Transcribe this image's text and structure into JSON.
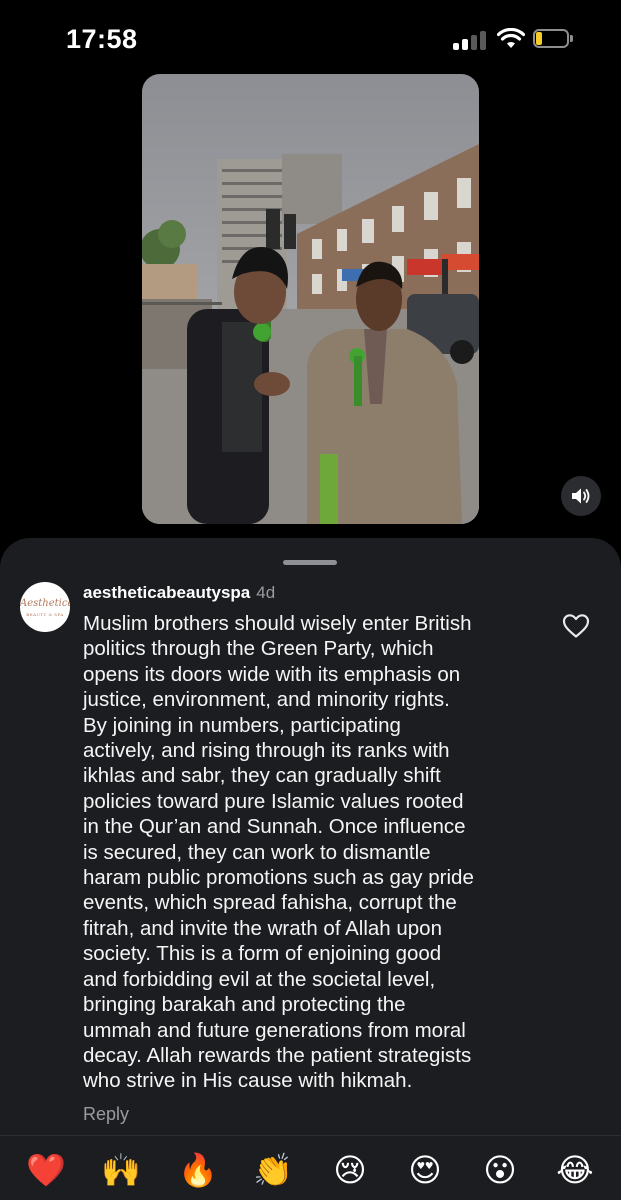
{
  "status_bar": {
    "time": "17:58",
    "battery_level": 0.2,
    "battery_color": "#f5cc28",
    "signal_bars_active": 2
  },
  "video": {
    "sound_icon": "speaker-icon"
  },
  "comment": {
    "username": "aestheticabeautyspa",
    "time_ago": "4d",
    "avatar_text": "Aesthetica",
    "avatar_subtext": "BEAUTY & SPA",
    "body_lines": [
      "Muslim brothers should wisely enter British",
      "politics through the Green Party, which",
      "opens its doors wide with its emphasis on",
      "justice, environment, and minority rights.",
      "By joining in numbers, participating",
      "actively, and rising through its ranks with",
      "ikhlas and sabr, they can gradually shift",
      "policies toward pure Islamic values rooted",
      "in the Qur’an and Sunnah. Once influence",
      "is secured, they can work to dismantle",
      "haram public promotions such as gay pride",
      "events, which spread fahisha, corrupt the",
      "fitrah, and invite the wrath of Allah upon",
      "society. This is a form of enjoining good",
      "and forbidding evil at the societal level,",
      "bringing barakah and protecting the",
      "ummah and future generations from moral",
      "decay. Allah rewards the patient strategists",
      "who strive in His cause with hikmah."
    ],
    "reply_label": "Reply",
    "like_icon": "heart-outline-icon"
  },
  "emoji_bar": {
    "emojis": [
      "❤️",
      "🙌",
      "🔥",
      "👏",
      "😢",
      "😍",
      "😮",
      "😂"
    ]
  },
  "colors": {
    "background": "#000000",
    "sheet": "#1c1d21",
    "muted_text": "#9a9ba0"
  }
}
